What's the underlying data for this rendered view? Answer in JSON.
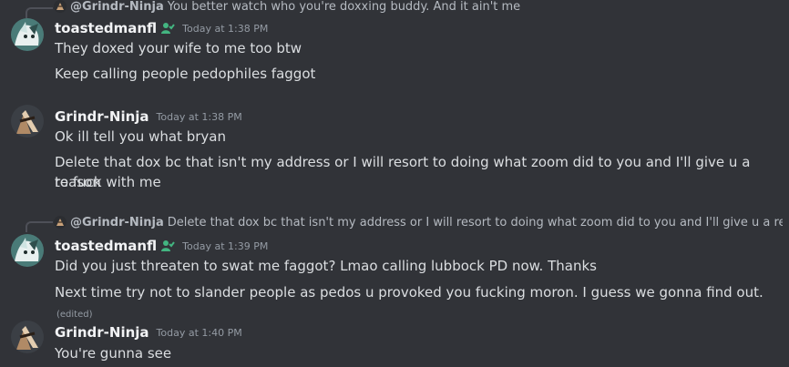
{
  "colors": {
    "background": "#313338",
    "text": "#dbdee1",
    "username": "#f2f3f5",
    "muted": "#949ba4",
    "role_badge": "#43b581"
  },
  "groups": [
    {
      "reply": {
        "icon": "ninja-avatar-icon",
        "username": "@Grindr-Ninja",
        "text": "You better watch who you're doxxing buddy. And it ain't me"
      },
      "author": {
        "name": "toastedmanfl",
        "avatar": "anime-avatar-icon",
        "badge": "role-badge-icon"
      },
      "timestamp": "Today at 1:38 PM",
      "lines": [
        "They doxed your wife to me too btw",
        "Keep calling people pedophiles faggot"
      ]
    },
    {
      "author": {
        "name": "Grindr-Ninja",
        "avatar": "ninja-avatar-icon"
      },
      "timestamp": "Today at 1:38 PM",
      "lines": [
        "Ok ill tell you what bryan",
        "Delete that dox bc that isn't my address or I will resort to doing what zoom did to you and I'll give u a reason",
        "to fuck with me"
      ]
    },
    {
      "reply": {
        "icon": "ninja-avatar-icon",
        "username": "@Grindr-Ninja",
        "text": "Delete that dox bc that isn't my address or I will resort to doing what zoom did to you and I'll give u a reas"
      },
      "author": {
        "name": "toastedmanfl",
        "avatar": "anime-avatar-icon",
        "badge": "role-badge-icon"
      },
      "timestamp": "Today at 1:39 PM",
      "lines": [
        "Did you just threaten to swat me faggot? Lmao calling lubbock PD now. Thanks",
        "Next time try not to slander people as pedos u provoked you fucking moron. I guess we gonna find out."
      ],
      "edited": "(edited)"
    },
    {
      "author": {
        "name": "Grindr-Ninja",
        "avatar": "ninja-avatar-icon"
      },
      "timestamp": "Today at 1:40 PM",
      "lines": [
        "You're gunna see"
      ]
    }
  ]
}
